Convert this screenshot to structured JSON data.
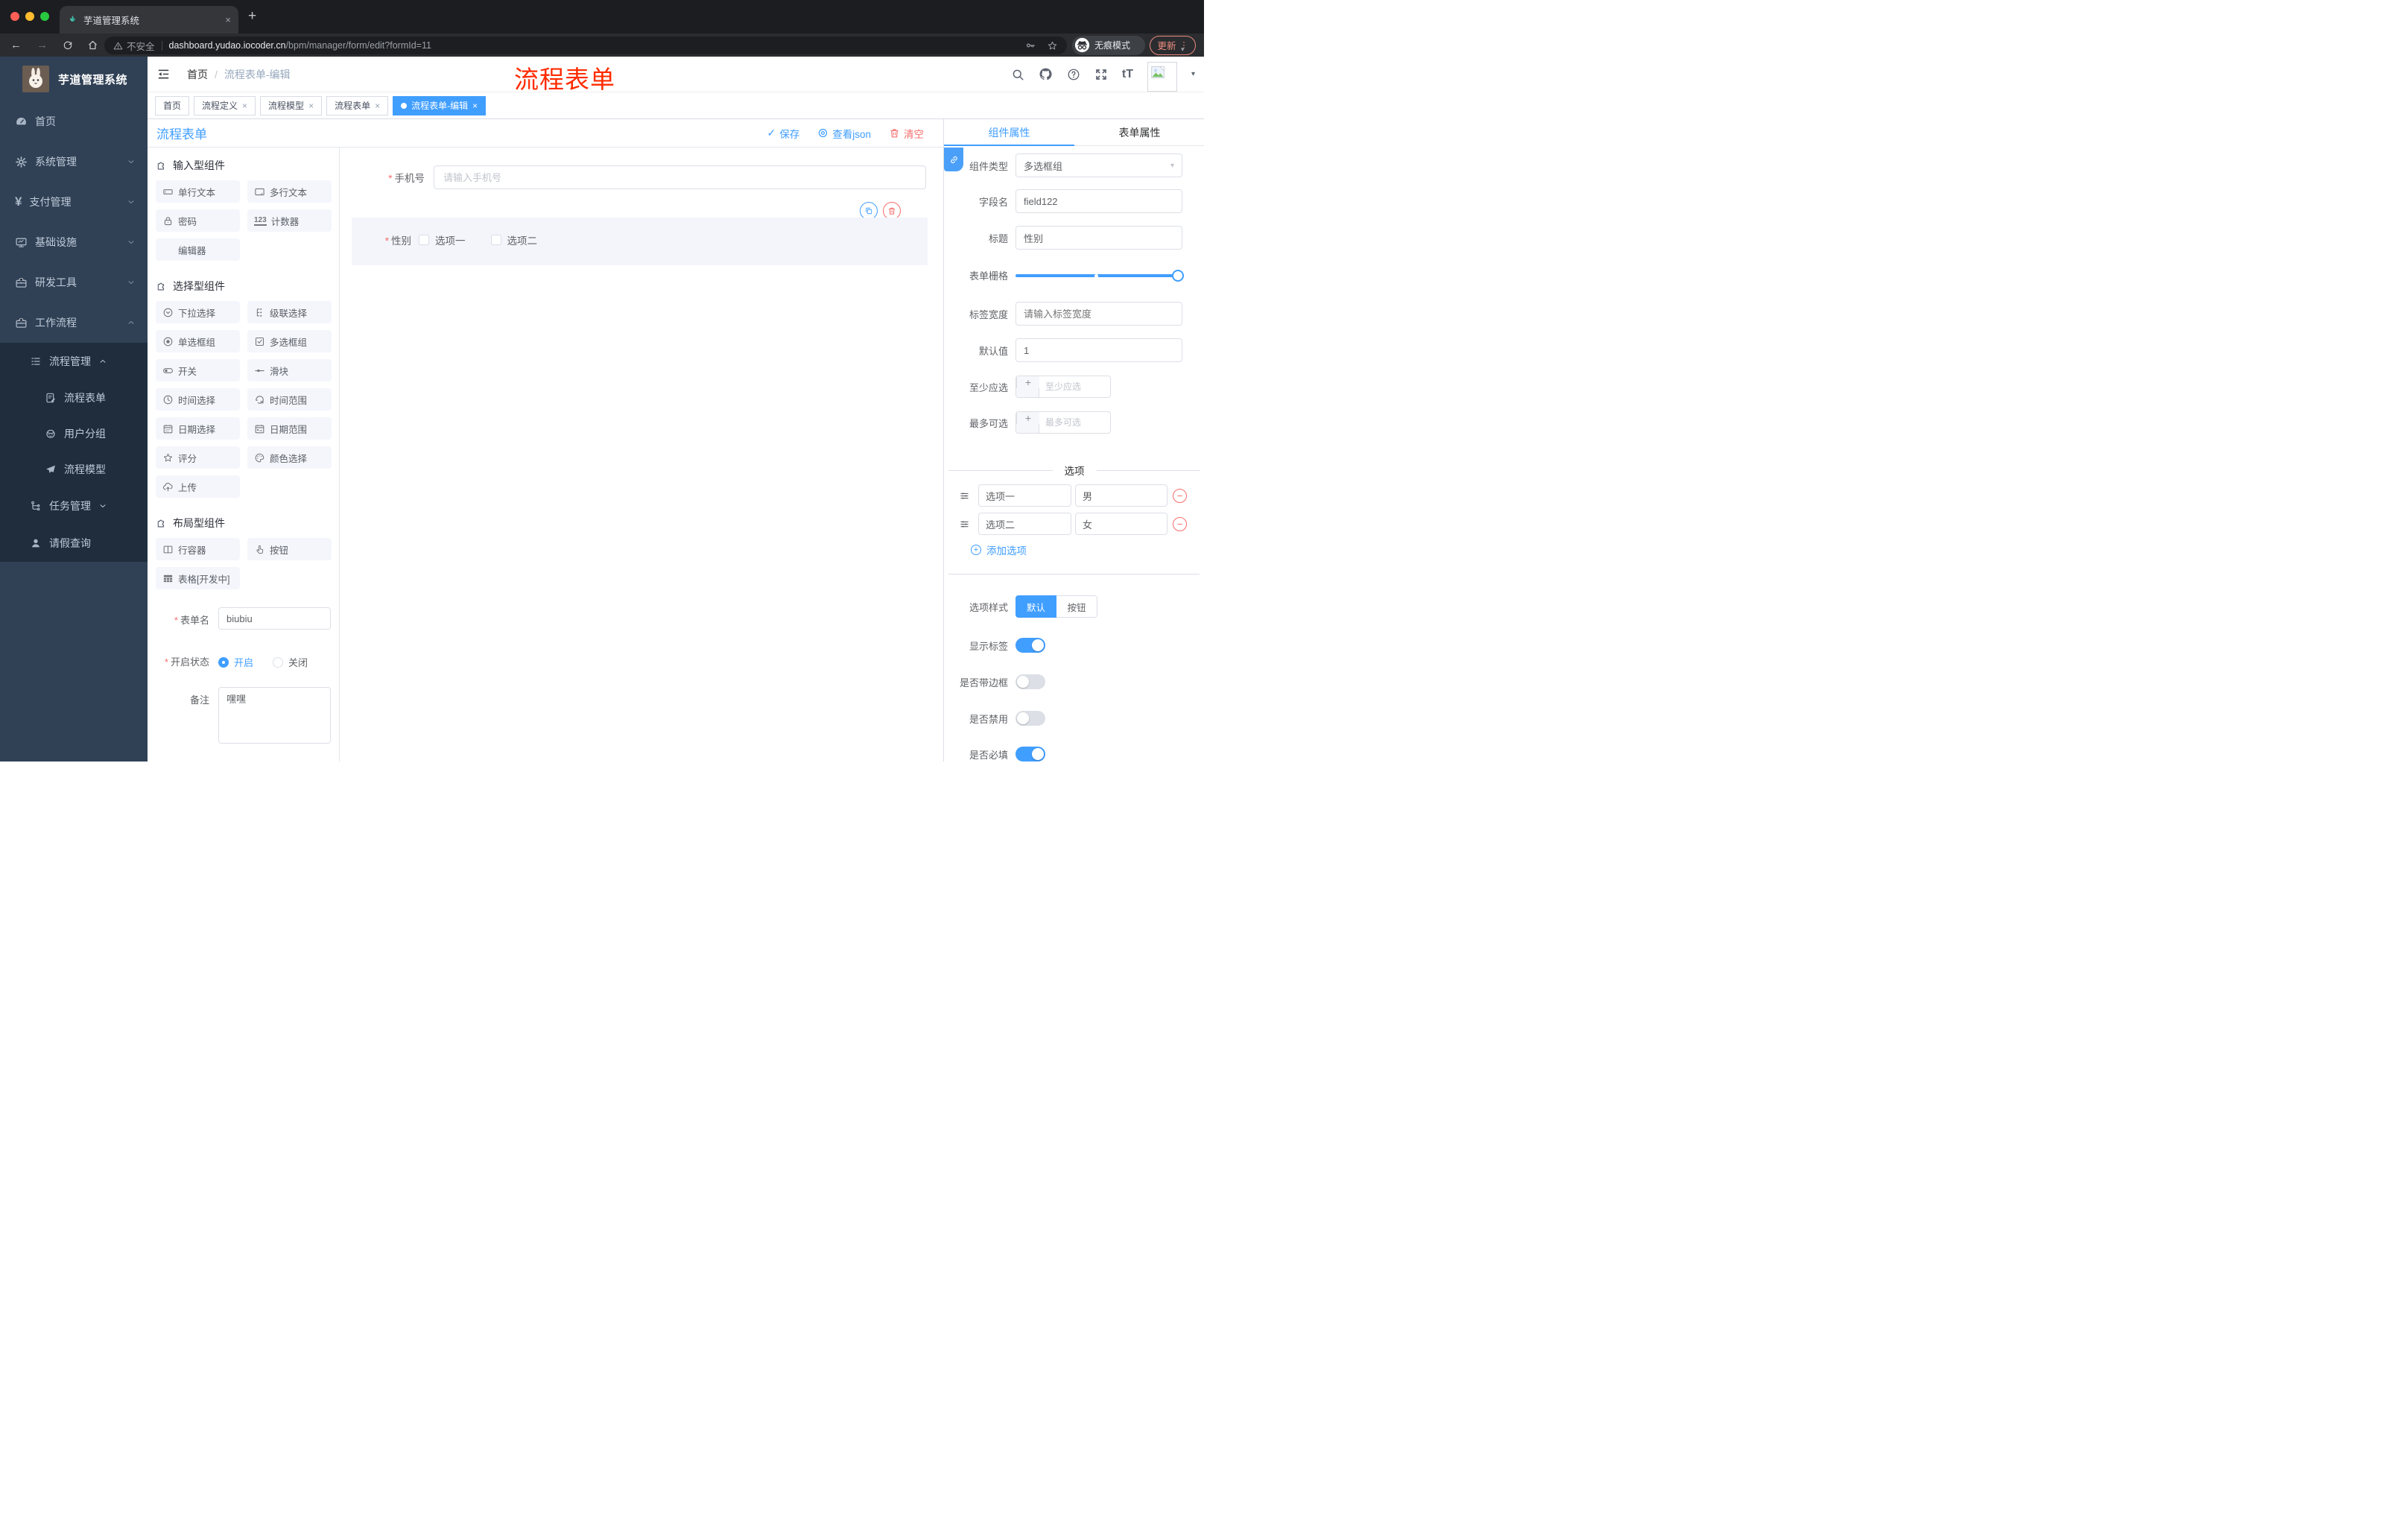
{
  "glyphs": {
    "close": "×",
    "plus": "+",
    "minus": "−",
    "caret_down": "▾",
    "check": "✓",
    "kebab": "⋮",
    "slash": "/",
    "required": "*",
    "dot_back": "←",
    "dot_forward": "→",
    "counter_icon_text": "123",
    "fontsize_icon_text": "tT",
    "question": "?",
    "yen": "¥",
    "new_tab": "+"
  },
  "browser": {
    "tab_title": "芋道管理系统",
    "security_label": "不安全",
    "url_domain": "dashboard.yudao.iocoder.cn",
    "url_path": "/bpm/manager/form/edit?formId=11",
    "incognito_label": "无痕模式",
    "update_label": "更新"
  },
  "sidebar": {
    "logo_title": "芋道管理系统",
    "items": [
      {
        "label": "首页"
      },
      {
        "label": "系统管理"
      },
      {
        "label": "支付管理"
      },
      {
        "label": "基础设施"
      },
      {
        "label": "研发工具"
      },
      {
        "label": "工作流程"
      }
    ],
    "submenu": {
      "group_label": "流程管理",
      "children": [
        {
          "label": "流程表单"
        },
        {
          "label": "用户分组"
        },
        {
          "label": "流程模型"
        }
      ],
      "siblings": [
        {
          "label": "任务管理"
        },
        {
          "label": "请假查询"
        }
      ]
    }
  },
  "header": {
    "breadcrumb_root": "首页",
    "breadcrumb_current": "流程表单-编辑",
    "annotation": "流程表单",
    "annotation_color": "#FF2B00"
  },
  "page_tabs": {
    "tabs": [
      {
        "label": "首页"
      },
      {
        "label": "流程定义"
      },
      {
        "label": "流程模型"
      },
      {
        "label": "流程表单"
      },
      {
        "label": "流程表单-编辑"
      }
    ]
  },
  "toolbar": {
    "title": "流程表单",
    "save_label": "保存",
    "view_json_label": "查看json",
    "clear_label": "清空"
  },
  "components_panel": {
    "sections": [
      {
        "title": "输入型组件",
        "items": [
          {
            "label": "单行文本"
          },
          {
            "label": "多行文本"
          },
          {
            "label": "密码"
          },
          {
            "label": "计数器"
          },
          {
            "label": "编辑器"
          }
        ]
      },
      {
        "title": "选择型组件",
        "items": [
          {
            "label": "下拉选择"
          },
          {
            "label": "级联选择"
          },
          {
            "label": "单选框组"
          },
          {
            "label": "多选框组"
          },
          {
            "label": "开关"
          },
          {
            "label": "滑块"
          },
          {
            "label": "时间选择"
          },
          {
            "label": "时间范围"
          },
          {
            "label": "日期选择"
          },
          {
            "label": "日期范围"
          },
          {
            "label": "评分"
          },
          {
            "label": "颜色选择"
          },
          {
            "label": "上传"
          }
        ]
      },
      {
        "title": "布局型组件",
        "items": [
          {
            "label": "行容器"
          },
          {
            "label": "按钮"
          },
          {
            "label": "表格[开发中]"
          }
        ]
      }
    ],
    "form": {
      "name_label": "表单名",
      "name_value": "biubiu",
      "status_label": "开启状态",
      "status_on": "开启",
      "status_off": "关闭",
      "remark_label": "备注",
      "remark_value": "嘿嘿"
    }
  },
  "canvas": {
    "phone": {
      "label": "手机号",
      "placeholder": "请输入手机号"
    },
    "gender": {
      "label": "性别",
      "option1": "选项一",
      "option2": "选项二"
    }
  },
  "props": {
    "tab_component": "组件属性",
    "tab_form": "表单属性",
    "component_type_label": "组件类型",
    "component_type_value": "多选框组",
    "field_name_label": "字段名",
    "field_name_value": "field122",
    "title_label": "标题",
    "title_value": "性别",
    "grid_label": "表单栅格",
    "label_width_label": "标签宽度",
    "label_width_placeholder": "请输入标签宽度",
    "default_label": "默认值",
    "default_value": "1",
    "min_label": "至少应选",
    "min_placeholder": "至少应选",
    "max_label": "最多可选",
    "max_placeholder": "最多可选",
    "options_title": "选项",
    "options": [
      {
        "name": "选项一",
        "value": "男"
      },
      {
        "name": "选项二",
        "value": "女"
      }
    ],
    "add_option_label": "添加选项",
    "style_label": "选项样式",
    "style_default": "默认",
    "style_button": "按钮",
    "show_label_label": "显示标签",
    "border_label": "是否带边框",
    "disabled_label": "是否禁用",
    "required_label": "是否必填"
  },
  "colors": {
    "accent": "#409EFF",
    "danger": "#F56C6C",
    "sidebar_bg": "#304156",
    "submenu_bg": "#1F2D3D"
  }
}
